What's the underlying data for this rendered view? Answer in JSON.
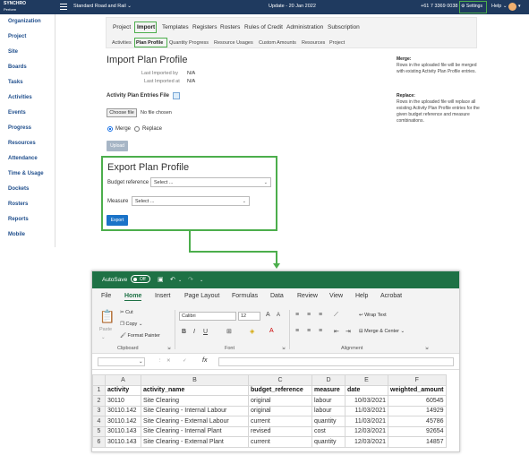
{
  "topbar": {
    "logo_line1": "SYNCHRO",
    "logo_line2": "Perform",
    "project": "Standard Road and Rail ⌄",
    "update": "Update - 20 Jan 2022",
    "phone": "+61 7 3369 0038",
    "settings": "⚙ Settings",
    "help": "Help ⌄"
  },
  "sidebar": {
    "items": [
      "Organization",
      "Project",
      "Site",
      "Boards",
      "Tasks",
      "Activities",
      "Events",
      "Progress",
      "Resources",
      "Attendance",
      "Time & Usage",
      "Dockets",
      "Rosters",
      "Reports",
      "Mobile"
    ]
  },
  "nav": {
    "items": [
      "Project",
      "Import",
      "Templates",
      "Registers",
      "Rosters",
      "Rules of Credit",
      "Administration",
      "Subscription"
    ],
    "subitems": [
      "Activities",
      "Plan Profile",
      "Quantity Progress",
      "Resource Usages",
      "Custom Amounts",
      "Resources",
      "Project"
    ]
  },
  "import": {
    "title": "Import Plan Profile",
    "last_by_label": "Last Imported by",
    "last_by_value": "N/A",
    "last_at_label": "Last Imported at",
    "last_at_value": "N/A",
    "file_label": "Activity Plan Entries File",
    "choose_label": "Choose file",
    "no_file": "No file chosen",
    "merge_label": "Merge",
    "replace_label": "Replace",
    "upload_label": "Upload"
  },
  "notes": {
    "merge_title": "Merge:",
    "merge_text": "Rows in the uploaded file will be merged with existing Activity Plan Profile entries.",
    "replace_title": "Replace:",
    "replace_text": "Rows in the uploaded file will replace all existing Activity Plan Profile entries for the given budget reference and measure combinations."
  },
  "export": {
    "title": "Export Plan Profile",
    "budget_label": "Budget reference",
    "budget_value": "Select ...",
    "measure_label": "Measure",
    "measure_value": "Select ...",
    "button": "Export"
  },
  "excel": {
    "autosave": "AutoSave",
    "toggle": "Off",
    "menu": [
      "File",
      "Home",
      "Insert",
      "Page Layout",
      "Formulas",
      "Data",
      "Review",
      "View",
      "Help",
      "Acrobat"
    ],
    "ribbon": {
      "paste": "Paste",
      "cut": "Cut",
      "copy": "Copy",
      "format_painter": "Format Painter",
      "clipboard": "Clipboard",
      "font_name": "Calibri",
      "font_size": "12",
      "font_group": "Font",
      "wrap_text": "Wrap Text",
      "merge_center": "Merge & Center",
      "alignment_group": "Alignment"
    },
    "fx": "fx",
    "columns": [
      "A",
      "B",
      "C",
      "D",
      "E",
      "F"
    ],
    "rows": [
      [
        "activity",
        "activity_name",
        "budget_reference",
        "measure",
        "date",
        "weighted_amount"
      ],
      [
        "30110",
        "Site Clearing",
        "original",
        "labour",
        "10/03/2021",
        "60545"
      ],
      [
        "30110.142",
        "Site Clearing - Internal Labour",
        "original",
        "labour",
        "11/03/2021",
        "14929"
      ],
      [
        "30110.142",
        "Site Clearing - External Labour",
        "current",
        "quantity",
        "11/03/2021",
        "45786"
      ],
      [
        "30110.143",
        "Site Clearing - Internal Plant",
        "revised",
        "cost",
        "12/03/2021",
        "92654"
      ],
      [
        "30110.143",
        "Site Clearing - External Plant",
        "current",
        "quantity",
        "12/03/2021",
        "14857"
      ]
    ]
  },
  "colors": {
    "highlight": "#4cae4c",
    "excel_green": "#1e7145",
    "topbar": "#1f3a5f",
    "nav_link": "#1f4e8c"
  }
}
